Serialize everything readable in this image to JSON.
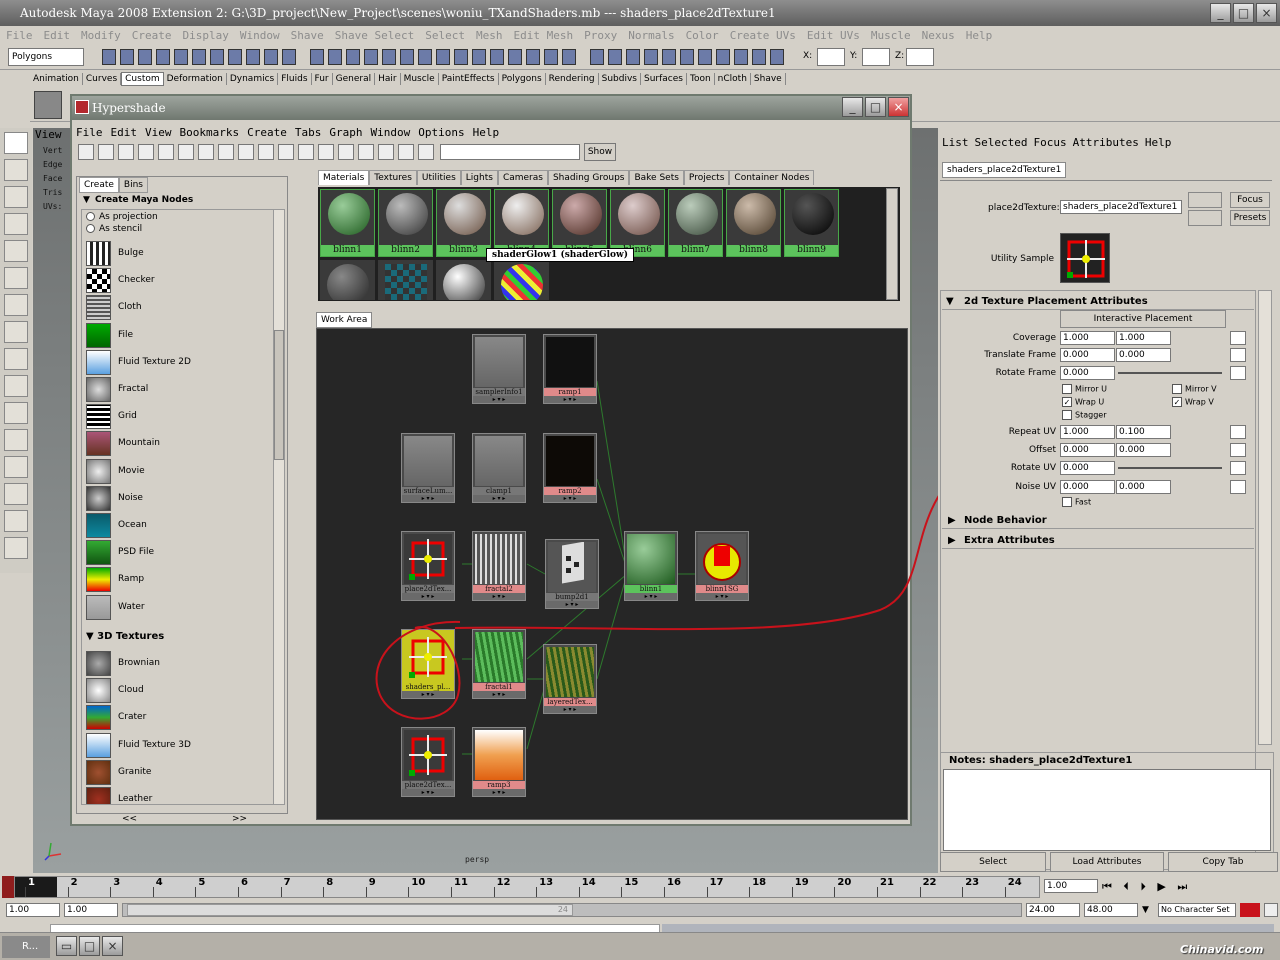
{
  "title": "Autodesk Maya 2008 Extension 2: G:\\3D_project\\New_Project\\scenes\\woniu_TXandShaders.mb    ---    shaders_place2dTexture1",
  "menus": [
    "File",
    "Edit",
    "Modify",
    "Create",
    "Display",
    "Window",
    "Shave",
    "Shave Select",
    "Select",
    "Mesh",
    "Edit Mesh",
    "Proxy",
    "Normals",
    "Color",
    "Create UVs",
    "Edit UVs",
    "Muscle",
    "Nexus",
    "Help"
  ],
  "status": {
    "mode": "Polygons",
    "x_label": "X:",
    "y_label": "Y:",
    "z_label": "Z:"
  },
  "shelf_tabs": [
    "Animation",
    "Curves",
    "Custom",
    "Deformation",
    "Dynamics",
    "Fluids",
    "Fur",
    "General",
    "Hair",
    "Muscle",
    "PaintEffects",
    "Polygons",
    "Rendering",
    "Subdivs",
    "Surfaces",
    "Toon",
    "nCloth",
    "Shave"
  ],
  "shelf_active": "Custom",
  "viewport": {
    "menu_item": "View",
    "hud": [
      "Vert",
      "Edge",
      "Face",
      "Tris",
      "UVs:"
    ],
    "cam": "persp"
  },
  "hypershade": {
    "title": "Hypershade",
    "menus": [
      "File",
      "Edit",
      "View",
      "Bookmarks",
      "Create",
      "Tabs",
      "Graph",
      "Window",
      "Options",
      "Help"
    ],
    "show_button": "Show",
    "left_tabs": [
      "Create",
      "Bins"
    ],
    "create_header": "Create Maya Nodes",
    "radio": [
      "As projection",
      "As stencil"
    ],
    "nodes_2d": [
      "Bulge",
      "Checker",
      "Cloth",
      "File",
      "Fluid Texture 2D",
      "Fractal",
      "Grid",
      "Mountain",
      "Movie",
      "Noise",
      "Ocean",
      "PSD File",
      "Ramp",
      "Water"
    ],
    "header_3d": "3D Textures",
    "nodes_3d": [
      "Brownian",
      "Cloud",
      "Crater",
      "Fluid Texture 3D",
      "Granite",
      "Leather"
    ],
    "nav": [
      "<<",
      ">>"
    ],
    "mat_tabs": [
      "Materials",
      "Textures",
      "Utilities",
      "Lights",
      "Cameras",
      "Shading Groups",
      "Bake Sets",
      "Projects",
      "Container Nodes"
    ],
    "materials": [
      "blinn1",
      "blinn2",
      "blinn3",
      "blinn4",
      "blinn5",
      "blinn6",
      "blinn7",
      "blinn8",
      "blinn9"
    ],
    "tooltip": "shaderGlow1 (shaderGlow)",
    "work_tab": "Work Area",
    "graph_nodes": {
      "samplerInfo": "samplerInfo1",
      "ramp1": "ramp1",
      "surfaceLum": "surfaceLum...",
      "clamp": "clamp1",
      "ramp2": "ramp2",
      "place1": "place2dTex...",
      "fractal2": "fractal2",
      "bump": "bump2d1",
      "blinn1": "blinn1",
      "blinnSG": "blinn1SG",
      "sel": "shaders_pl...",
      "fractal1": "fractal1",
      "layered": "layeredTex...",
      "place3": "place2dTex...",
      "ramp3": "ramp3"
    }
  },
  "attr_editor": {
    "menus": [
      "List",
      "Selected",
      "Focus",
      "Attributes",
      "Help"
    ],
    "tab": "shaders_place2dTexture1",
    "node_label": "place2dTexture:",
    "node_value": "shaders_place2dTexture1",
    "focus": "Focus",
    "presets": "Presets",
    "sample_label": "Utility Sample",
    "section": "2d Texture Placement Attributes",
    "interactive": "Interactive Placement",
    "coverage": [
      "Coverage",
      "1.000",
      "1.000"
    ],
    "translate": [
      "Translate Frame",
      "0.000",
      "0.000"
    ],
    "rotate_frame": [
      "Rotate Frame",
      "0.000"
    ],
    "checks": {
      "mirror_u": "Mirror U",
      "mirror_v": "Mirror V",
      "wrap_u": "Wrap U",
      "wrap_v": "Wrap V",
      "stagger": "Stagger"
    },
    "repeat": [
      "Repeat UV",
      "1.000",
      "0.100"
    ],
    "offset": [
      "Offset",
      "0.000",
      "0.000"
    ],
    "rotate_uv": [
      "Rotate UV",
      "0.000"
    ],
    "noise": [
      "Noise UV",
      "0.000",
      "0.000"
    ],
    "fast": "Fast",
    "node_behavior": "Node Behavior",
    "extra": "Extra Attributes",
    "notes_label": "Notes:  shaders_place2dTexture1",
    "buttons": [
      "Select",
      "Load Attributes",
      "Copy Tab"
    ]
  },
  "timeline": {
    "ticks": [
      "1",
      "2",
      "3",
      "4",
      "5",
      "6",
      "7",
      "8",
      "9",
      "10",
      "11",
      "12",
      "13",
      "14",
      "15",
      "16",
      "17",
      "18",
      "19",
      "20",
      "21",
      "22",
      "23",
      "24"
    ],
    "current": "1.00"
  },
  "range": {
    "start": "1.00",
    "start2": "1.00",
    "mark": "24",
    "end": "24.00",
    "end2": "48.00",
    "char": "No Character Set"
  },
  "taskbar": {
    "app": "R...",
    "watermark": "Chinavid.com"
  },
  "colors": {
    "accent_green": "#5cc35c",
    "graph_bg": "#262626",
    "pink": "#e08a8a",
    "red_mark": "#c8121b"
  }
}
